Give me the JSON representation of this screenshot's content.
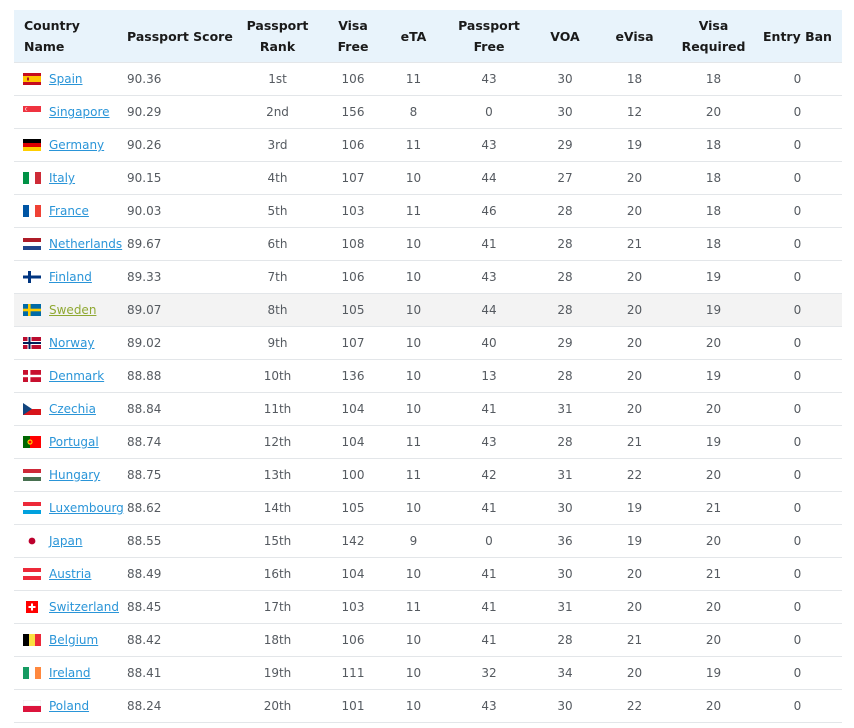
{
  "headers": {
    "country": "Country Name",
    "score": "Passport Score",
    "rank": "Passport\nRank",
    "visa_free": "Visa Free",
    "eta": "eTA",
    "passport_free": "Passport\nFree",
    "voa": "VOA",
    "evisa": "eVisa",
    "visa_required": "Visa\nRequired",
    "entry_ban": "Entry Ban"
  },
  "rows": [
    {
      "flag": "spain-flag-icon",
      "country": "Spain",
      "score": "90.36",
      "rank": "1st",
      "visa_free": "106",
      "eta": "11",
      "passport_free": "43",
      "voa": "30",
      "evisa": "18",
      "visa_required": "18",
      "entry_ban": "0"
    },
    {
      "flag": "singapore-flag-icon",
      "country": "Singapore",
      "score": "90.29",
      "rank": "2nd",
      "visa_free": "156",
      "eta": "8",
      "passport_free": "0",
      "voa": "30",
      "evisa": "12",
      "visa_required": "20",
      "entry_ban": "0"
    },
    {
      "flag": "germany-flag-icon",
      "country": "Germany",
      "score": "90.26",
      "rank": "3rd",
      "visa_free": "106",
      "eta": "11",
      "passport_free": "43",
      "voa": "29",
      "evisa": "19",
      "visa_required": "18",
      "entry_ban": "0"
    },
    {
      "flag": "italy-flag-icon",
      "country": "Italy",
      "score": "90.15",
      "rank": "4th",
      "visa_free": "107",
      "eta": "10",
      "passport_free": "44",
      "voa": "27",
      "evisa": "20",
      "visa_required": "18",
      "entry_ban": "0"
    },
    {
      "flag": "france-flag-icon",
      "country": "France",
      "score": "90.03",
      "rank": "5th",
      "visa_free": "103",
      "eta": "11",
      "passport_free": "46",
      "voa": "28",
      "evisa": "20",
      "visa_required": "18",
      "entry_ban": "0"
    },
    {
      "flag": "netherlands-flag-icon",
      "country": "Netherlands",
      "score": "89.67",
      "rank": "6th",
      "visa_free": "108",
      "eta": "10",
      "passport_free": "41",
      "voa": "28",
      "evisa": "21",
      "visa_required": "18",
      "entry_ban": "0"
    },
    {
      "flag": "finland-flag-icon",
      "country": "Finland",
      "score": "89.33",
      "rank": "7th",
      "visa_free": "106",
      "eta": "10",
      "passport_free": "43",
      "voa": "28",
      "evisa": "20",
      "visa_required": "19",
      "entry_ban": "0"
    },
    {
      "flag": "sweden-flag-icon",
      "country": "Sweden",
      "score": "89.07",
      "rank": "8th",
      "visa_free": "105",
      "eta": "10",
      "passport_free": "44",
      "voa": "28",
      "evisa": "20",
      "visa_required": "19",
      "entry_ban": "0",
      "highlighted": true
    },
    {
      "flag": "norway-flag-icon",
      "country": "Norway",
      "score": "89.02",
      "rank": "9th",
      "visa_free": "107",
      "eta": "10",
      "passport_free": "40",
      "voa": "29",
      "evisa": "20",
      "visa_required": "20",
      "entry_ban": "0"
    },
    {
      "flag": "denmark-flag-icon",
      "country": "Denmark",
      "score": "88.88",
      "rank": "10th",
      "visa_free": "136",
      "eta": "10",
      "passport_free": "13",
      "voa": "28",
      "evisa": "20",
      "visa_required": "19",
      "entry_ban": "0"
    },
    {
      "flag": "czechia-flag-icon",
      "country": "Czechia",
      "score": "88.84",
      "rank": "11th",
      "visa_free": "104",
      "eta": "10",
      "passport_free": "41",
      "voa": "31",
      "evisa": "20",
      "visa_required": "20",
      "entry_ban": "0"
    },
    {
      "flag": "portugal-flag-icon",
      "country": "Portugal",
      "score": "88.74",
      "rank": "12th",
      "visa_free": "104",
      "eta": "11",
      "passport_free": "43",
      "voa": "28",
      "evisa": "21",
      "visa_required": "19",
      "entry_ban": "0"
    },
    {
      "flag": "hungary-flag-icon",
      "country": "Hungary",
      "score": "88.75",
      "rank": "13th",
      "visa_free": "100",
      "eta": "11",
      "passport_free": "42",
      "voa": "31",
      "evisa": "22",
      "visa_required": "20",
      "entry_ban": "0"
    },
    {
      "flag": "luxembourg-flag-icon",
      "country": "Luxembourg",
      "score": "88.62",
      "rank": "14th",
      "visa_free": "105",
      "eta": "10",
      "passport_free": "41",
      "voa": "30",
      "evisa": "19",
      "visa_required": "21",
      "entry_ban": "0"
    },
    {
      "flag": "japan-flag-icon",
      "country": "Japan",
      "score": "88.55",
      "rank": "15th",
      "visa_free": "142",
      "eta": "9",
      "passport_free": "0",
      "voa": "36",
      "evisa": "19",
      "visa_required": "20",
      "entry_ban": "0"
    },
    {
      "flag": "austria-flag-icon",
      "country": "Austria",
      "score": "88.49",
      "rank": "16th",
      "visa_free": "104",
      "eta": "10",
      "passport_free": "41",
      "voa": "30",
      "evisa": "20",
      "visa_required": "21",
      "entry_ban": "0"
    },
    {
      "flag": "switzerland-flag-icon",
      "country": "Switzerland",
      "score": "88.45",
      "rank": "17th",
      "visa_free": "103",
      "eta": "11",
      "passport_free": "41",
      "voa": "31",
      "evisa": "20",
      "visa_required": "20",
      "entry_ban": "0"
    },
    {
      "flag": "belgium-flag-icon",
      "country": "Belgium",
      "score": "88.42",
      "rank": "18th",
      "visa_free": "106",
      "eta": "10",
      "passport_free": "41",
      "voa": "28",
      "evisa": "21",
      "visa_required": "20",
      "entry_ban": "0"
    },
    {
      "flag": "ireland-flag-icon",
      "country": "Ireland",
      "score": "88.41",
      "rank": "19th",
      "visa_free": "111",
      "eta": "10",
      "passport_free": "32",
      "voa": "34",
      "evisa": "20",
      "visa_required": "19",
      "entry_ban": "0"
    },
    {
      "flag": "poland-flag-icon",
      "country": "Poland",
      "score": "88.24",
      "rank": "20th",
      "visa_free": "101",
      "eta": "10",
      "passport_free": "43",
      "voa": "30",
      "evisa": "22",
      "visa_required": "20",
      "entry_ban": "0"
    }
  ],
  "colors": {
    "header_bg": "#e8f3fb",
    "link": "#2a95d8",
    "link_highlighted": "#8fa832",
    "row_highlight": "#f3f3f3"
  }
}
